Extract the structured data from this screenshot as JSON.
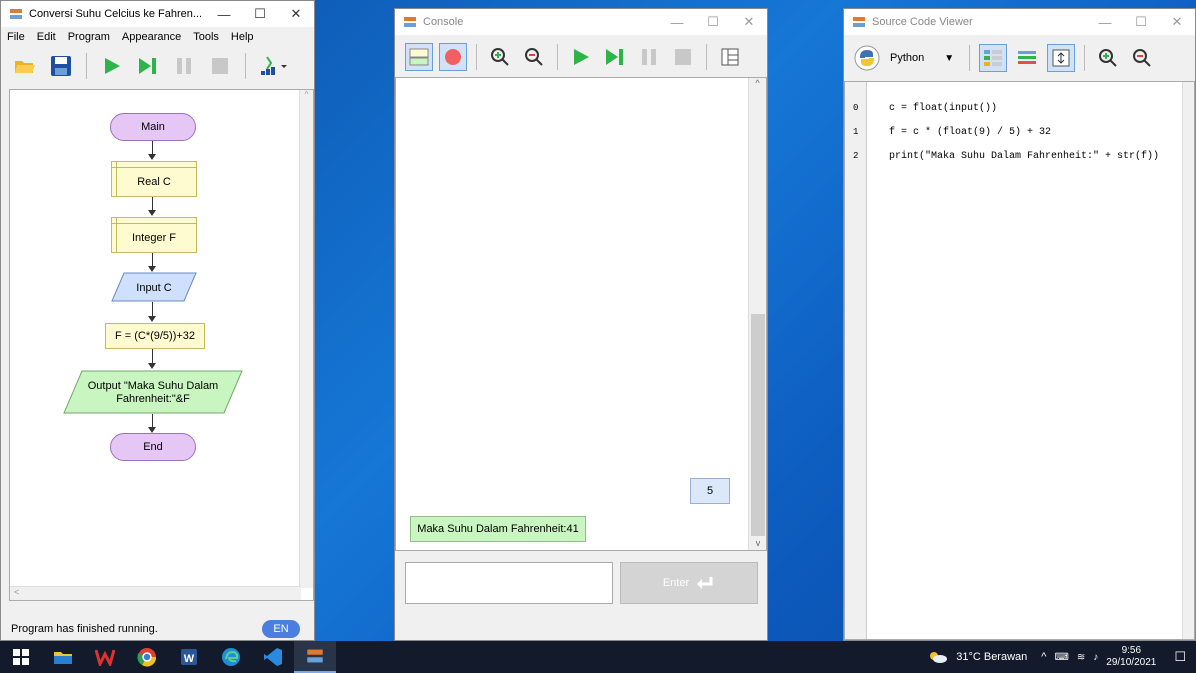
{
  "flowchart_window": {
    "title": "Conversi Suhu Celcius ke Fahren...",
    "menu": [
      "File",
      "Edit",
      "Program",
      "Appearance",
      "Tools",
      "Help"
    ],
    "nodes": {
      "main": "Main",
      "decl1": "Real C",
      "decl2": "Integer F",
      "input": "Input C",
      "assign": "F = (C*(9/5))+32",
      "output_line1": "Output \"Maka Suhu Dalam",
      "output_line2": "Fahrenheit:\"&F",
      "end": "End"
    },
    "status": "Program has finished running.",
    "language_badge": "EN"
  },
  "console_window": {
    "title": "Console",
    "input_bubble": "5",
    "output_bubble": "Maka Suhu Dalam Fahrenheit:41",
    "input_value": "",
    "enter_label": "Enter"
  },
  "source_window": {
    "title": "Source Code Viewer",
    "language": "Python",
    "lines": [
      {
        "num": "0",
        "code": "c = float(input())"
      },
      {
        "num": "1",
        "code": "f = c * (float(9) / 5) + 32"
      },
      {
        "num": "2",
        "code": "print(\"Maka Suhu Dalam Fahrenheit:\" + str(f))"
      }
    ]
  },
  "taskbar": {
    "weather": "31°C  Berawan",
    "time": "9:56",
    "date": "29/10/2021"
  },
  "colors": {
    "terminal_fill": "#e5c6f5",
    "declare_fill": "#fffbd0",
    "io_fill": "#cfe0ff",
    "output_fill": "#c9f5c0",
    "accent": "#4a7fe0"
  }
}
